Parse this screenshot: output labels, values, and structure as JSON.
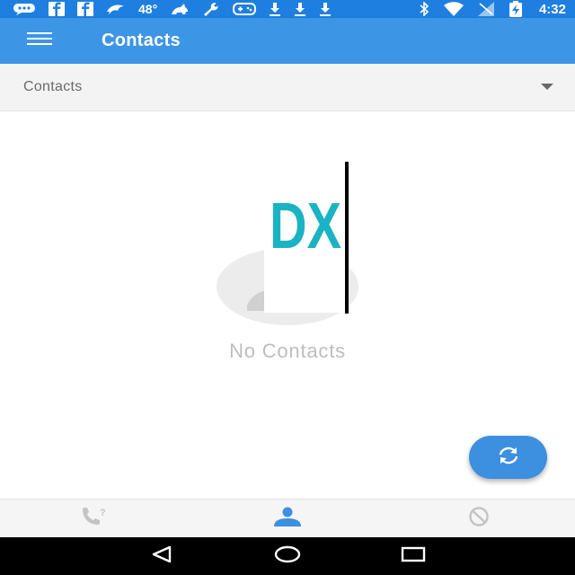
{
  "status_bar": {
    "temperature": "48°",
    "time": "4:32",
    "icons": [
      "chat-bubble-icon",
      "facebook-icon",
      "facebook-icon",
      "dolphin-icon",
      "pet-icon",
      "wrench-icon",
      "gamepad-icon",
      "download-icon",
      "download-icon",
      "download-icon",
      "bluetooth-icon",
      "wifi-icon",
      "no-signal-icon",
      "battery-charging-icon"
    ]
  },
  "app_bar": {
    "title": "Contacts",
    "menu_icon": "hamburger-menu-icon"
  },
  "filter": {
    "selected": "Contacts",
    "icon": "dropdown-arrow-icon"
  },
  "empty_state": {
    "message": "No Contacts",
    "overlay_text": "DX"
  },
  "fab": {
    "icon": "sync-icon"
  },
  "bottom_tabs": [
    {
      "name": "unknown-calls",
      "icon": "phone-question-icon",
      "active": false
    },
    {
      "name": "contacts",
      "icon": "person-icon",
      "active": true
    },
    {
      "name": "blocked",
      "icon": "block-icon",
      "active": false
    }
  ],
  "colors": {
    "status_bar": "#1f7fe0",
    "app_bar": "#3d95e6",
    "accent": "#3d8fe0",
    "inactive_icon": "#c4c4c4",
    "empty_text": "#bdbdbd",
    "dx_text": "#1ab3c4"
  },
  "nav_bar": {
    "buttons": [
      "back-icon",
      "home-icon",
      "recents-icon"
    ]
  }
}
